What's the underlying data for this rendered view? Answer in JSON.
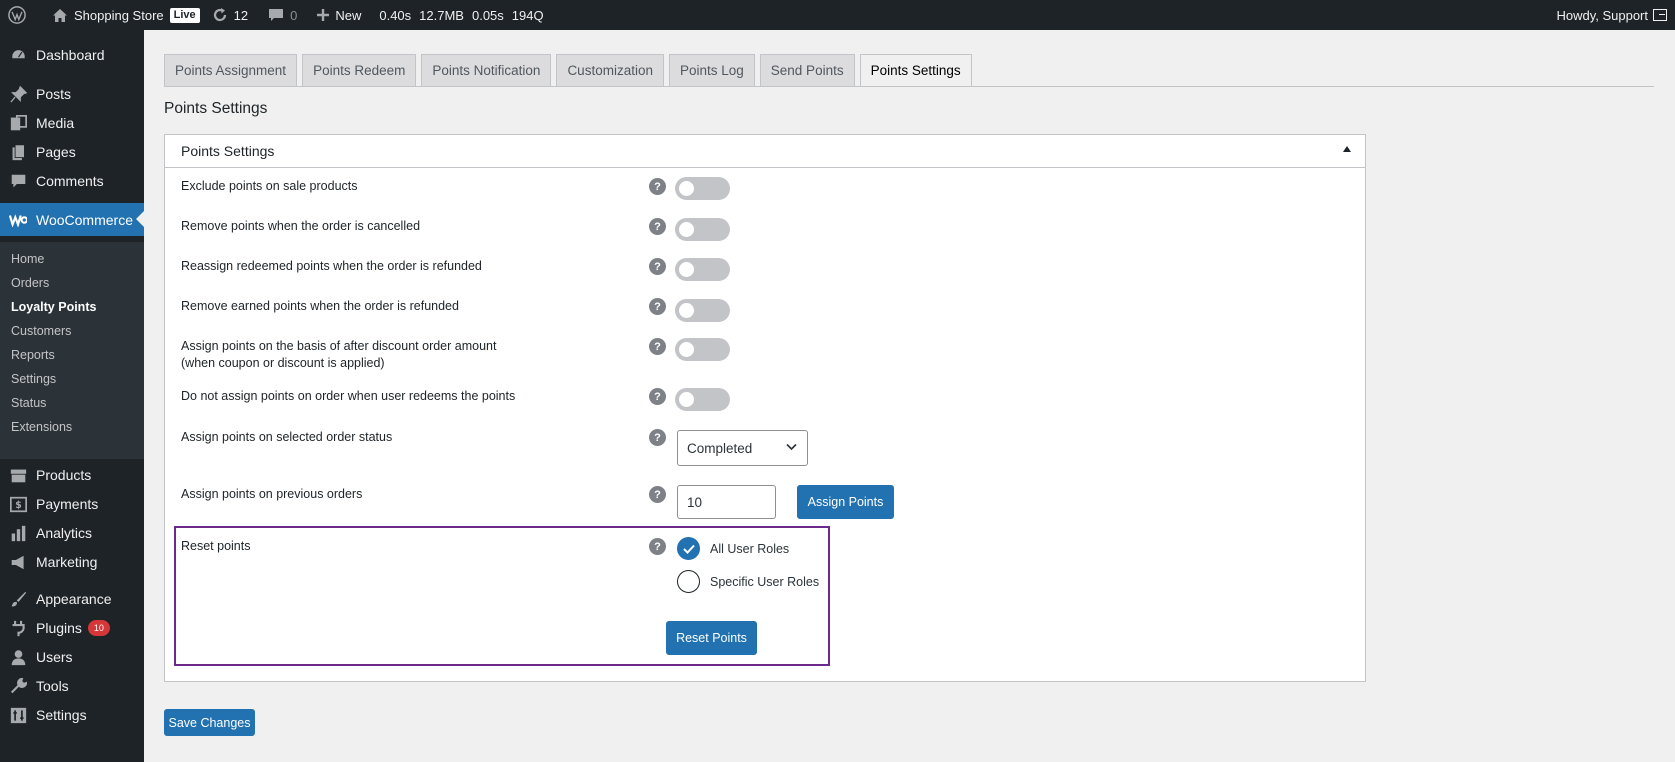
{
  "adminbar": {
    "site_name": "Shopping Store",
    "live_badge": "Live",
    "updates_count": "12",
    "comments_count": "0",
    "new_label": "New",
    "stats": [
      "0.40s",
      "12.7MB",
      "0.05s",
      "194Q"
    ],
    "greeting": "Howdy, Support"
  },
  "sidebar": {
    "items": [
      {
        "label": "Dashboard",
        "icon": "dashboard-icon"
      },
      {
        "label": "Posts",
        "icon": "pin-icon"
      },
      {
        "label": "Media",
        "icon": "media-icon"
      },
      {
        "label": "Pages",
        "icon": "pages-icon"
      },
      {
        "label": "Comments",
        "icon": "comment-icon"
      },
      {
        "label": "WooCommerce",
        "icon": "woocommerce-icon"
      },
      {
        "label": "Products",
        "icon": "archive-icon"
      },
      {
        "label": "Payments",
        "icon": "payments-icon"
      },
      {
        "label": "Analytics",
        "icon": "chart-bar-icon"
      },
      {
        "label": "Marketing",
        "icon": "megaphone-icon"
      },
      {
        "label": "Appearance",
        "icon": "brush-icon"
      },
      {
        "label": "Plugins",
        "icon": "plugin-icon",
        "badge": "10"
      },
      {
        "label": "Users",
        "icon": "user-icon"
      },
      {
        "label": "Tools",
        "icon": "wrench-icon"
      },
      {
        "label": "Settings",
        "icon": "settings-icon"
      }
    ],
    "submenu": [
      "Home",
      "Orders",
      "Loyalty Points",
      "Customers",
      "Reports",
      "Settings",
      "Status",
      "Extensions"
    ],
    "current_submenu": "Loyalty Points"
  },
  "tabs": [
    "Points Assignment",
    "Points Redeem",
    "Points Notification",
    "Customization",
    "Points Log",
    "Send Points",
    "Points Settings"
  ],
  "active_tab": "Points Settings",
  "page_title": "Points Settings",
  "panel": {
    "title": "Points Settings",
    "toggle_rows": [
      {
        "label": "Exclude points on sale products",
        "enabled": false
      },
      {
        "label": "Remove points when the order is cancelled",
        "enabled": false
      },
      {
        "label": "Reassign redeemed points when the order is refunded",
        "enabled": false
      },
      {
        "label": "Remove earned points when the order is refunded",
        "enabled": false
      },
      {
        "label": "Assign points on the basis of after discount order amount",
        "label2": "(when coupon or discount is applied)",
        "enabled": false
      },
      {
        "label": "Do not assign points on order when user redeems the points",
        "enabled": false
      }
    ],
    "order_status": {
      "label": "Assign points on selected order status",
      "value": "Completed"
    },
    "previous_orders": {
      "label": "Assign points on previous orders",
      "value": "10",
      "button": "Assign Points"
    },
    "reset": {
      "label": "Reset points",
      "options": [
        "All User Roles",
        "Specific User Roles"
      ],
      "selected": "All User Roles",
      "button": "Reset Points"
    },
    "help_glyph": "?"
  },
  "save_button": "Save Changes",
  "colors": {
    "primary": "#2271b1",
    "adminbar": "#1d2327",
    "highlight": "#6b2a8c"
  }
}
